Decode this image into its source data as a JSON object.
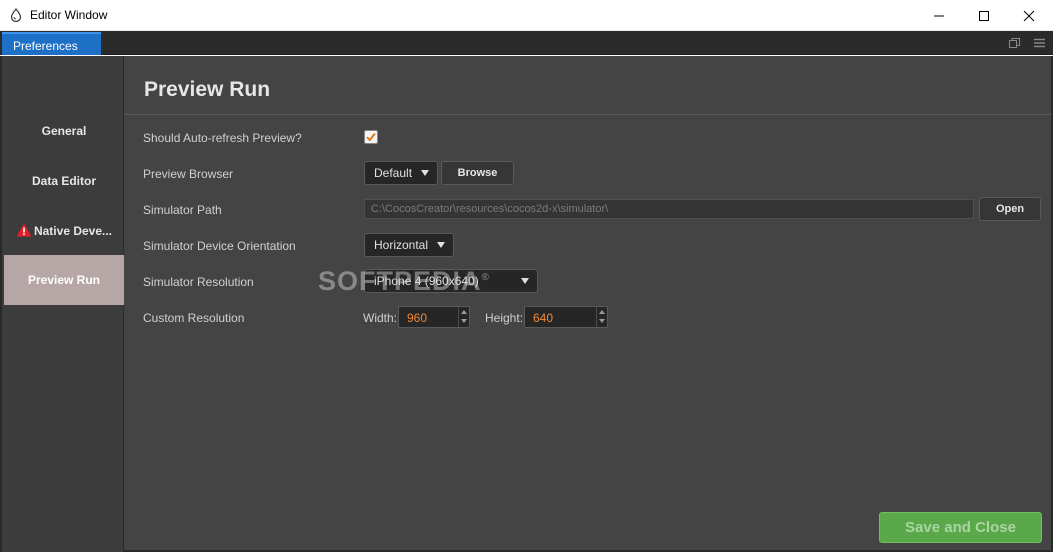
{
  "window": {
    "title": "Editor Window",
    "controls": [
      "minimize-icon",
      "maximize-icon",
      "close-icon"
    ]
  },
  "tabs": {
    "preferences_label": "Preferences",
    "right_icons": [
      "popout-icon",
      "menu-icon"
    ]
  },
  "sidebar": {
    "items": [
      {
        "label": "General",
        "active": false
      },
      {
        "label": "Data Editor",
        "active": false
      },
      {
        "label": "Native Deve...",
        "active": false,
        "icon": "warning-icon"
      },
      {
        "label": "Preview Run",
        "active": true
      }
    ]
  },
  "main": {
    "title": "Preview Run",
    "auto_refresh": {
      "label": "Should Auto-refresh Preview?",
      "checked": true
    },
    "preview_browser": {
      "label": "Preview Browser",
      "value": "Default",
      "browse_label": "Browse"
    },
    "simulator_path": {
      "label": "Simulator Path",
      "value": "C:\\CocosCreator\\resources\\cocos2d-x\\simulator\\",
      "open_label": "Open"
    },
    "orientation": {
      "label": "Simulator Device Orientation",
      "value": "Horizontal"
    },
    "resolution": {
      "label": "Simulator Resolution",
      "value": "iPhone 4 (960x640)"
    },
    "custom_resolution": {
      "label": "Custom Resolution",
      "width_label": "Width:",
      "width_value": "960",
      "height_label": "Height:",
      "height_value": "640"
    },
    "save_label": "Save and Close"
  },
  "watermark": {
    "text": "SOFTPEDIA",
    "mark": "®"
  },
  "colors": {
    "accent_tab": "#1e6fc6",
    "active_sidebar": "#b7a6a6",
    "checkbox_tick": "#e07b1f",
    "number_text": "#f08a36",
    "save_button": "#5aa84a"
  }
}
